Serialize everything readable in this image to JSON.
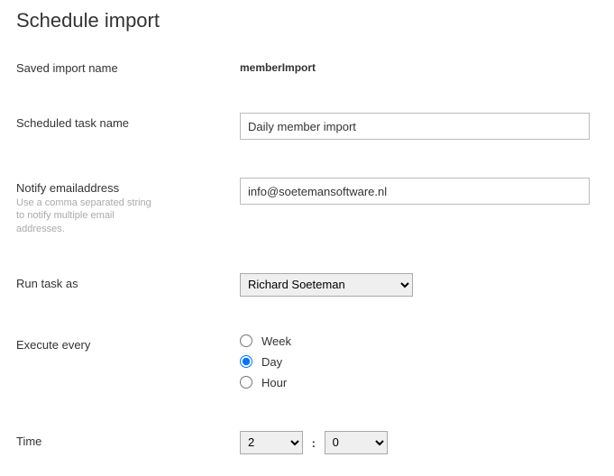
{
  "page": {
    "title": "Schedule import"
  },
  "labels": {
    "savedImportName": "Saved import name",
    "scheduledTaskName": "Scheduled task name",
    "notifyEmail": "Notify emailaddress",
    "notifyEmailHelp": "Use a comma separated string to notify multiple email addresses.",
    "runTaskAs": "Run task as",
    "executeEvery": "Execute every",
    "time": "Time"
  },
  "values": {
    "savedImportName": "memberImport",
    "scheduledTaskName": "Daily member import",
    "notifyEmail": "info@soetemansoftware.nl",
    "runTaskAs": "Richard Soeteman",
    "timeHour": "2",
    "timeMinute": "0",
    "timeSeparator": ":"
  },
  "executeEvery": {
    "options": [
      {
        "label": "Week",
        "checked": false
      },
      {
        "label": "Day",
        "checked": true
      },
      {
        "label": "Hour",
        "checked": false
      }
    ]
  }
}
